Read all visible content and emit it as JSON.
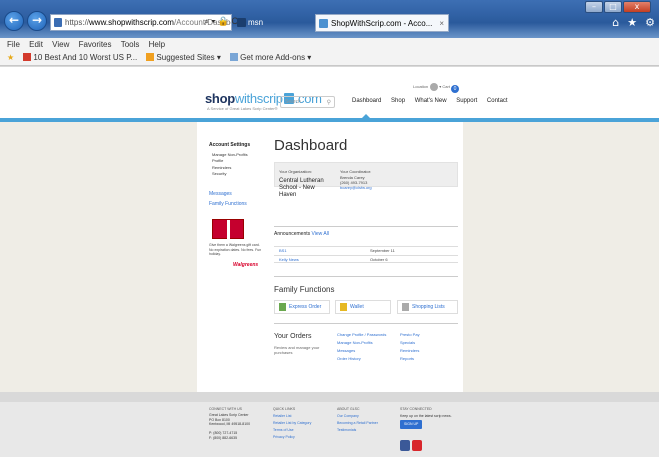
{
  "browser": {
    "url_prefix": "https://",
    "url_domain": "www.shopwithscrip.com",
    "url_path": "/Account/Dashboa",
    "url_icons": "⌕ ▾ 🔒 C",
    "tabs": [
      {
        "label": "msn",
        "close": ""
      },
      {
        "label": "ShopWithScrip.com - Acco...",
        "close": "×"
      }
    ],
    "right_icons": [
      "⌂",
      "★",
      "⚙"
    ],
    "window_buttons": [
      "–",
      "□",
      "x"
    ],
    "menu": [
      "File",
      "Edit",
      "View",
      "Favorites",
      "Tools",
      "Help"
    ],
    "favorites": [
      "10 Best And 10 Worst US P...",
      "Suggested Sites ▾",
      "Get more Add-ons ▾"
    ]
  },
  "site": {
    "logo_bold": "shop",
    "logo_light": "withscrip",
    "logo_tail": ".com",
    "tagline": "A Service of Great Lakes Scrip Center®",
    "search_placeholder": "Search",
    "nav": [
      "Dashboard",
      "Shop",
      "What's New",
      "Support",
      "Contact"
    ],
    "account_left": "Location",
    "account_right": "Cart",
    "cart_count": "0"
  },
  "sidebar": {
    "heading": "Account Settings",
    "items": [
      "Manage Non-Profits",
      "Profile",
      "Reminders",
      "Security"
    ],
    "messages": "Messages",
    "family_functions": "Family Functions",
    "promo_text": "Give them a Walgreens gift card. No expiration dates. No fees. Fun holiday.",
    "promo_brand": "Walgreens"
  },
  "dashboard": {
    "title": "Dashboard",
    "org_label": "Your Organization:",
    "org_name": "Central Lutheran School - New Haven",
    "coord_label": "Your Coordinator:",
    "coord_name": "Brenda Carey",
    "coord_phone": "(260) 493-7913",
    "coord_email": "bcarey@clsfw.org",
    "announcements_label": "Announcements",
    "view_all": "View All",
    "announcements": [
      {
        "title": "BS1",
        "date": "September 11"
      },
      {
        "title": "Kelly News",
        "date": "October 6"
      }
    ],
    "family_functions_title": "Family Functions",
    "ff_buttons": [
      "Express Order",
      "Wallet",
      "Shopping Lists"
    ],
    "orders_title": "Your Orders",
    "orders_sub": "Review and manage your purchases",
    "order_links_1": [
      "Change Profile / Passwords",
      "Manage Non-Profits",
      "Messages",
      "Order History"
    ],
    "order_links_2": [
      "Presto Pay",
      "Specials",
      "Reminders",
      "Reports"
    ]
  },
  "footer": {
    "col1_h": "CONNECT WITH US",
    "col1_lines": [
      "Great Lakes Scrip Center",
      "PO Box 8100",
      "Kentwood, MI 49518-8100",
      "",
      "P: (800) 727-4715",
      "F: (800) 882-6635"
    ],
    "col2_h": "QUICK LINKS",
    "col2_links": [
      "Retailer List",
      "Retailer List by Category",
      "Terms of Use",
      "Privacy Policy"
    ],
    "col3_h": "ABOUT GLSC",
    "col3_links": [
      "Our Company",
      "Becoming a Retail Partner",
      "Testimonials"
    ],
    "col4_h": "STAY CONNECTED",
    "col4_text": "Keep up on the latest scrip news.",
    "signup": "SIGN UP"
  }
}
